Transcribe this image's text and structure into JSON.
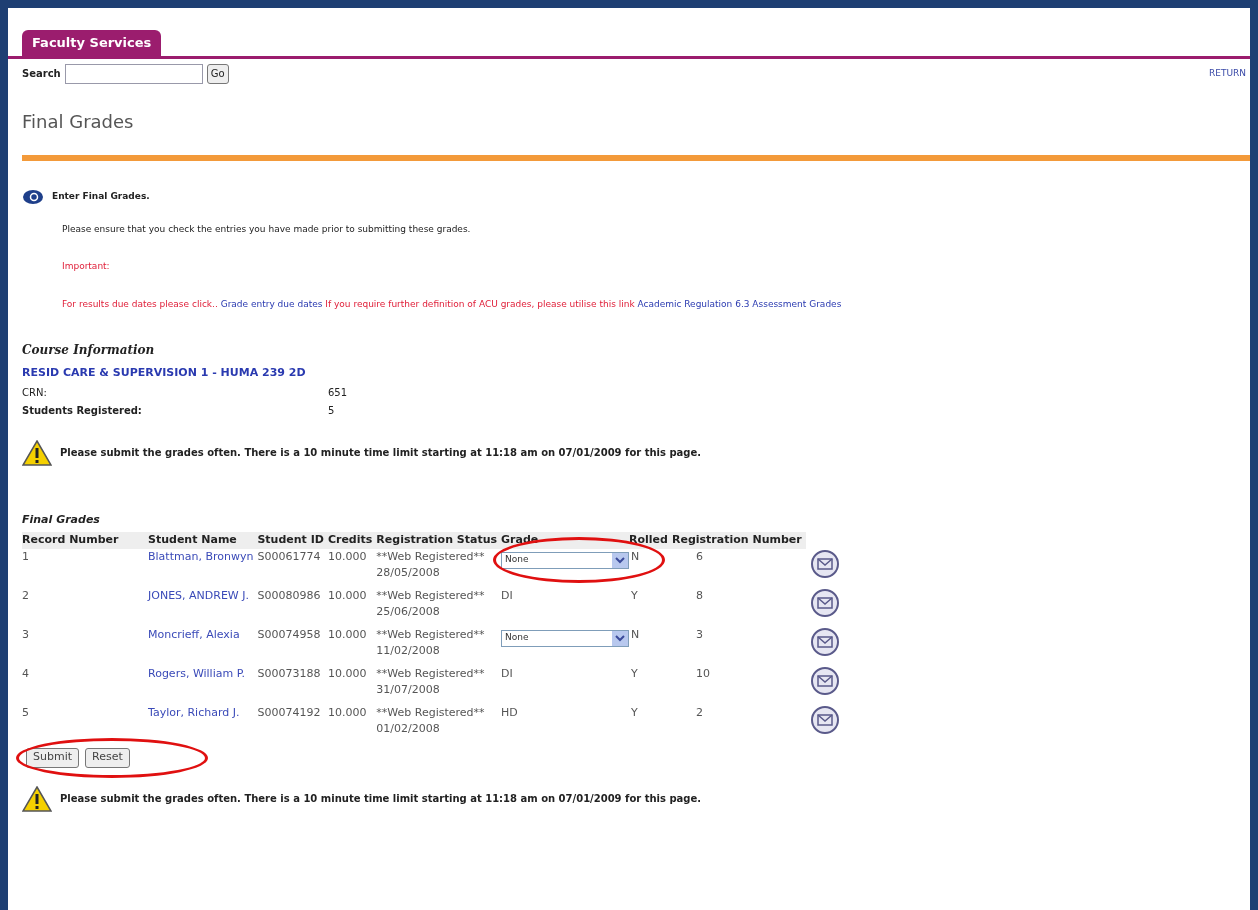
{
  "tab": {
    "label": "Faculty Services",
    "selected": true
  },
  "search": {
    "label": "Search",
    "button": "Go"
  },
  "return_link": "RETURN",
  "page_title": "Final Grades",
  "info": {
    "heading": "Enter Final Grades.",
    "text": "Please ensure that you check the entries you have made prior to submitting these grades.",
    "important": "Important:",
    "notice_parts": [
      {
        "kind": "text",
        "text": "For results due dates please click.."
      },
      {
        "kind": "link",
        "text": "Grade entry due dates"
      },
      {
        "kind": "text",
        "text": "If you require further definition of ACU grades, please utilise this link"
      },
      {
        "kind": "link",
        "text": "Academic Regulation 6.3 Assessment Grades"
      }
    ]
  },
  "course": {
    "heading": "Course Information",
    "title": "RESID CARE & SUPERVISION 1 - HUMA 239 2D",
    "fields": [
      {
        "label": "CRN:",
        "value": "651"
      },
      {
        "label": "Students Registered:",
        "value": "5"
      }
    ]
  },
  "warning_top": "Please submit the grades often. There is a 10 minute time limit starting at 11:18 am on 07/01/2009 for this page.",
  "grades": {
    "heading": "Final Grades",
    "columns": [
      "Record Number",
      "Student Name",
      "Student ID",
      "Credits",
      "Registration Status",
      "Grade",
      "Rolled",
      "Registration Number"
    ],
    "rows": [
      {
        "record": "1",
        "name": "Blattman, Bronwyn",
        "id": "S00061774",
        "credits": "10.000",
        "status": "**Web Registered**",
        "date": "28/05/2008",
        "kind": "select",
        "grade": "None",
        "rolled": "N",
        "reg": "6",
        "highlighted": true
      },
      {
        "record": "2",
        "name": "JONES, ANDREW J.",
        "id": "S00080986",
        "credits": "10.000",
        "status": "**Web Registered**",
        "date": "25/06/2008",
        "kind": "text",
        "grade": "DI",
        "rolled": "Y",
        "reg": "8",
        "highlighted": false
      },
      {
        "record": "3",
        "name": "Moncrieff, Alexia",
        "id": "S00074958",
        "credits": "10.000",
        "status": "**Web Registered**",
        "date": "11/02/2008",
        "kind": "select",
        "grade": "None",
        "rolled": "N",
        "reg": "3",
        "highlighted": false
      },
      {
        "record": "4",
        "name": "Rogers, William P.",
        "id": "S00073188",
        "credits": "10.000",
        "status": "**Web Registered**",
        "date": "31/07/2008",
        "kind": "text",
        "grade": "DI",
        "rolled": "Y",
        "reg": "10",
        "highlighted": false
      },
      {
        "record": "5",
        "name": "Taylor, Richard J.",
        "id": "S00074192",
        "credits": "10.000",
        "status": "**Web Registered**",
        "date": "01/02/2008",
        "kind": "text",
        "grade": "HD",
        "rolled": "Y",
        "reg": "2",
        "highlighted": false
      }
    ]
  },
  "buttons": {
    "items": [
      "Submit",
      "Reset"
    ],
    "highlighted": true
  },
  "warning_bottom": "Please submit the grades often. There is a 10 minute time limit starting at 11:18 am on 07/01/2009 for this page."
}
